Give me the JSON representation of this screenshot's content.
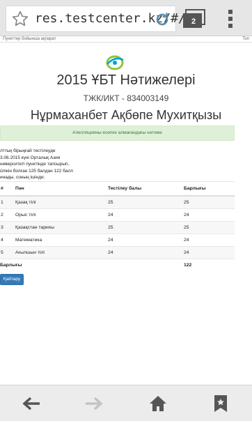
{
  "browser": {
    "url": "res.testcenter.kz/#/",
    "tab_count": "2"
  },
  "site": {
    "top_left": "Пункттер бойынша ақпарат",
    "top_right": "Топ"
  },
  "header": {
    "title": "2015 ҰБТ Нәтижелері",
    "subtitle": "ТЖК/ИКТ - 834003149",
    "person": "Нұрмаханбет Ақбөпе Мухитқызы"
  },
  "alert": "Апелляцияны есепке алмағандағы нәтиже",
  "description": [
    "лттық бірыңғай тестілеуде",
    "3.06.2015 күні Орталық Азия",
    "ниверситеті пунктінде тапсырып,",
    "ümкін болған 125 балдан 122 балл",
    "инады, соның ішінде:"
  ],
  "table": {
    "headers": [
      "#",
      "Пән",
      "Тестілеу балы",
      "Барлығы"
    ],
    "rows": [
      [
        "1",
        "Қазақ тілі",
        "25",
        "25"
      ],
      [
        "2",
        "Орыс тілі",
        "24",
        "24"
      ],
      [
        "3",
        "Қазақстан тарихы",
        "25",
        "25"
      ],
      [
        "4",
        "Математика",
        "24",
        "24"
      ],
      [
        "5",
        "Ағылшын тілі",
        "24",
        "24"
      ]
    ],
    "total_label": "Барлығы",
    "total_value": "122"
  },
  "back_button": "Қайтару",
  "colors": {
    "alert_bg": "#dff0d8",
    "alert_text": "#3c763d",
    "button": "#337ab7",
    "logo_green": "#8dc63f",
    "logo_blue": "#00a0d2"
  },
  "icons": {
    "bookmark_star": "star-icon",
    "reload": "reload-icon",
    "tabs": "tabs-icon",
    "menu": "overflow-menu-icon",
    "back": "back-arrow-icon",
    "forward": "forward-arrow-icon",
    "home": "home-icon",
    "bookmarks": "bookmark-icon"
  }
}
